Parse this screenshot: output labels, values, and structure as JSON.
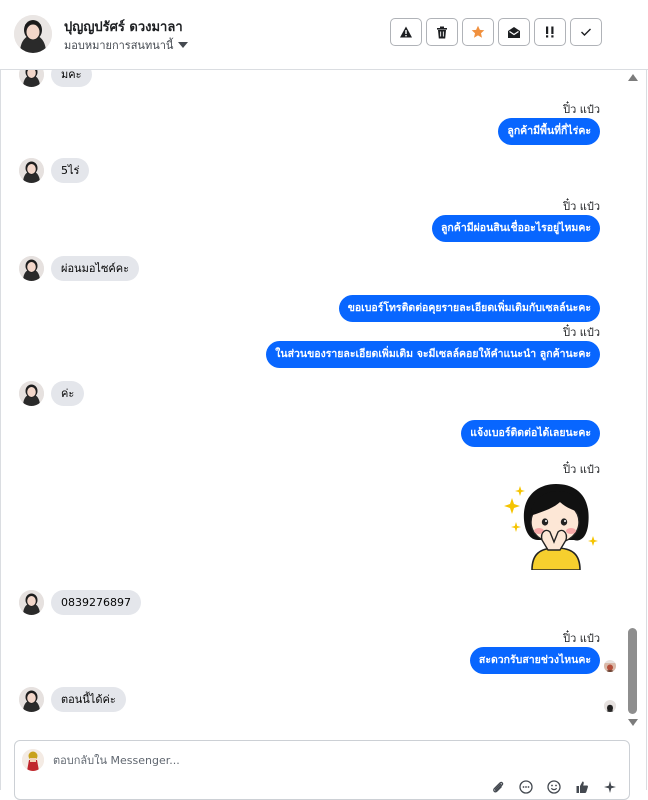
{
  "header": {
    "contact_name": "ปุญญปรัศร์ ดวงมาลา",
    "assign_label": "มอบหมายการสนทนานี้",
    "actions": [
      {
        "name": "report-spam-button",
        "icon": "warning-icon"
      },
      {
        "name": "delete-button",
        "icon": "trash-icon"
      },
      {
        "name": "star-button",
        "icon": "star-icon"
      },
      {
        "name": "mark-unread-button",
        "icon": "envelope-open-icon"
      },
      {
        "name": "follow-up-button",
        "icon": "double-exclaim-icon"
      },
      {
        "name": "mark-done-button",
        "icon": "check-icon"
      }
    ]
  },
  "colors": {
    "accent": "#0866ff",
    "incoming_bubble": "#e4e6eb",
    "star": "#f0903e"
  },
  "messages": {
    "m1_in": "มคะ",
    "m2_sender": "ปิ๋ว แป๋ว",
    "m2_out": "ลูกค้ามีพื้นที่กี่ไร่คะ",
    "m3_in": "5ไร่",
    "m4_sender": "ปิ๋ว แป๋ว",
    "m4_out": "ลูกค้ามีผ่อนสินเชื่ออะไรอยู่ไหมคะ",
    "m5_in": "ผ่อนมอไซค์คะ",
    "m6_out": "ขอเบอร์โทรติดต่อคุยรายละเอียดเพิ่มเติมกับเซลล์นะคะ",
    "m7_sender": "ปิ๋ว แป๋ว",
    "m7_out": "ในส่วนของรายละเอียดเพิ่มเติม จะมีเซลล์คอยให้คำแนะนำ ลูกค้านะคะ",
    "m8_in": "ค่ะ",
    "m9_out": "แจ้งเบอร์ติดต่อได้เลยนะคะ",
    "m10_sender": "ปิ๋ว แป๋ว",
    "m11_in": "0839276897",
    "m12_sender": "ปิ๋ว แป๋ว",
    "m12_out": "สะดวกรับสายช่วงไหนคะ",
    "m13_in": "ตอนนี้ได้ค่ะ"
  },
  "composer": {
    "placeholder": "ตอบกลับใน Messenger...",
    "tools": [
      "paperclip-icon",
      "saved-reply-icon",
      "emoji-icon",
      "like-icon",
      "sparkle-icon"
    ]
  }
}
